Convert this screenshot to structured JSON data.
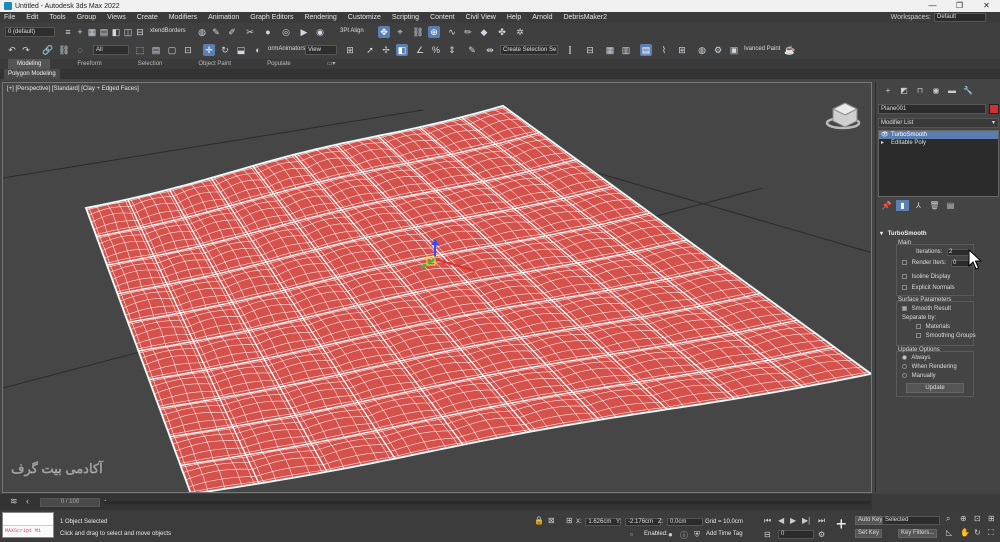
{
  "window": {
    "title": "Untitled - Autodesk 3ds Max 2022",
    "controls": [
      "—",
      "❐",
      "✕"
    ]
  },
  "menu": {
    "items": [
      "File",
      "Edit",
      "Tools",
      "Group",
      "Views",
      "Create",
      "Modifiers",
      "Animation",
      "Graph Editors",
      "Rendering",
      "Customize",
      "Scripting",
      "Content",
      "Civil View",
      "Help",
      "Arnold",
      "DebrisMaker2"
    ],
    "workspace_label": "Workspaces:",
    "workspace_value": "Default"
  },
  "toolbar1": {
    "layer_box": "0 (default)",
    "xtend_label": "xtendBorders",
    "align_label": "3Pt Align"
  },
  "toolbar2": {
    "filter_value": "All",
    "animators_label": "ormAnimators",
    "view_value": "View",
    "selection_set": "Create Selection Se",
    "paint_label": "Ivanced Paint"
  },
  "ribbon": {
    "tabs": [
      "Modeling",
      "Freeform",
      "Selection",
      "Object Paint",
      "Populate"
    ],
    "subtab": "Polygon Modeling"
  },
  "viewport": {
    "label": "[+] [Perspective] [Standard] [Clay + Edged Faces]",
    "watermark": "آکادمی بیت گرف",
    "surface_color": "#d4514c",
    "wire_color": "#ffffff"
  },
  "command_panel": {
    "object_name": "Plane001",
    "object_color": "#d03030",
    "modifier_list": "Modifier List",
    "stack": [
      {
        "label": "TurboSmooth",
        "selected": true
      },
      {
        "label": "Editable Poly",
        "selected": false
      }
    ]
  },
  "turbosmooth": {
    "title": "TurboSmooth",
    "main_label": "Main",
    "iterations_label": "Iterations:",
    "iterations_value": "2",
    "render_iters_label": "Render Iters:",
    "render_iters_value": "0",
    "isoline_label": "Isoline Display",
    "explicit_label": "Explicit Normals",
    "surface_label": "Surface Parameters",
    "smooth_result_label": "Smooth Result",
    "separate_label": "Separate by:",
    "materials_label": "Materials",
    "smoothing_groups_label": "Smoothing Groups",
    "update_options_label": "Update Options",
    "always_label": "Always",
    "when_rendering_label": "When Rendering",
    "manually_label": "Manually",
    "update_button": "Update"
  },
  "timebar": {
    "time_value": "0 / 100"
  },
  "status": {
    "maxscript_label": "MAXScript Mi",
    "selected_text": "1 Object Selected",
    "prompt_text": "Click and drag to select and move objects",
    "x_label": "X:",
    "x_value": "1.626cm",
    "y_label": "Y:",
    "y_value": "-2.176cm",
    "z_label": "Z:",
    "z_value": "0.0cm",
    "grid_text": "Grid = 10.0cm",
    "enabled_label": "Enabled:",
    "add_time_tag": "Add Time Tag",
    "frame_value": "0",
    "auto_key": "Auto Key",
    "set_key": "Set Key",
    "selected_dd": "Selected",
    "key_filters": "Key Filters..."
  }
}
